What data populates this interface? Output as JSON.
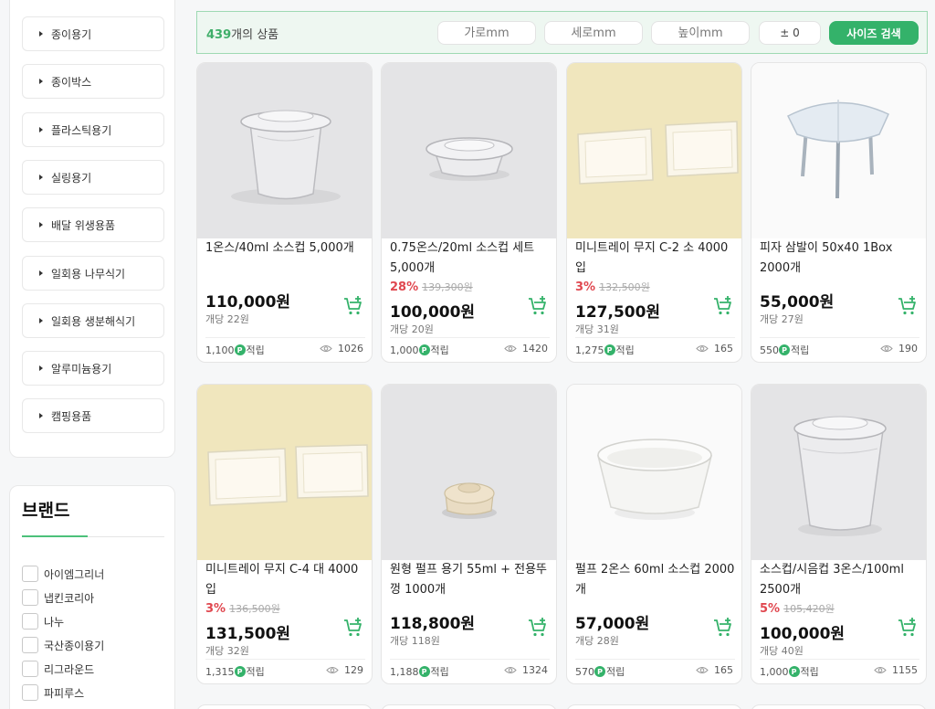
{
  "sidebar": {
    "categories": [
      "종이용기",
      "종이박스",
      "플라스틱용기",
      "실링용기",
      "배달 위생용품",
      "일회용 나무식기",
      "일회용 생분해식기",
      "알루미늄용기",
      "캠핑용품"
    ]
  },
  "brand_filter": {
    "title": "브랜드",
    "items": [
      "아이엠그리너",
      "냅킨코리아",
      "나누",
      "국산종이용기",
      "리그라운드",
      "파피루스"
    ]
  },
  "search": {
    "count": "439",
    "count_suffix": "개의 상품",
    "width_placeholder": "가로mm",
    "depth_placeholder": "세로mm",
    "height_placeholder": "높이mm",
    "tolerance": "± 0",
    "button": "사이즈 검색"
  },
  "colors": {
    "accent": "#34b26a",
    "discount": "#e0474f"
  },
  "point_badge": "P",
  "products": [
    {
      "name": "1온스/40ml 소스컵 5,000개",
      "discount": "",
      "original": "",
      "price": "110,000원",
      "unit": "개당 22원",
      "points": "1,100",
      "points_suffix": "적립",
      "views": "1026",
      "image": "clear-cup-lid"
    },
    {
      "name": "0.75온스/20ml 소스컵 세트 5,000개",
      "discount": "28%",
      "original": "139,300원",
      "price": "100,000원",
      "unit": "개당 20원",
      "points": "1,000",
      "points_suffix": "적립",
      "views": "1420",
      "image": "small-clear-cup"
    },
    {
      "name": "미니트레이 무지 C-2 소 4000입",
      "discount": "3%",
      "original": "132,500원",
      "price": "127,500원",
      "unit": "개당 31원",
      "points": "1,275",
      "points_suffix": "적립",
      "views": "165",
      "image": "paper-trays"
    },
    {
      "name": "피자 삼발이 50x40 1Box 2000개",
      "discount": "",
      "original": "",
      "price": "55,000원",
      "unit": "개당 27원",
      "points": "550",
      "points_suffix": "적립",
      "views": "190",
      "image": "pizza-stand"
    },
    {
      "name": "미니트레이 무지 C-4 대 4000입",
      "discount": "3%",
      "original": "136,500원",
      "price": "131,500원",
      "unit": "개당 32원",
      "points": "1,315",
      "points_suffix": "적립",
      "views": "129",
      "image": "paper-trays"
    },
    {
      "name": "원형 펄프 용기 55ml + 전용뚜껑 1000개",
      "discount": "",
      "original": "",
      "price": "118,800원",
      "unit": "개당 118원",
      "points": "1,188",
      "points_suffix": "적립",
      "views": "1324",
      "image": "pulp-container"
    },
    {
      "name": "펄프 2온스 60ml 소스컵 2000개",
      "discount": "",
      "original": "",
      "price": "57,000원",
      "unit": "개당 28원",
      "points": "570",
      "points_suffix": "적립",
      "views": "165",
      "image": "pulp-cup"
    },
    {
      "name": "소스컵/시음컵 3온스/100ml 2500개",
      "discount": "5%",
      "original": "105,420원",
      "price": "100,000원",
      "unit": "개당 40원",
      "points": "1,000",
      "points_suffix": "적립",
      "views": "1155",
      "image": "tall-clear-cup"
    }
  ]
}
